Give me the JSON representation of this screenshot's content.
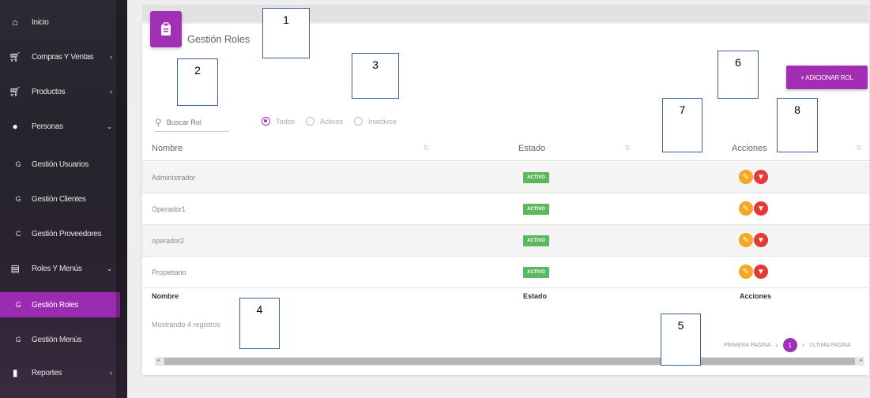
{
  "sidebar": {
    "items": [
      {
        "icon": "home-icon",
        "glyph": "⌂",
        "label": "Inicio",
        "arrow": ""
      },
      {
        "icon": "cart-icon",
        "glyph": "🛒",
        "label": "Compras Y Ventas",
        "arrow": "‹"
      },
      {
        "icon": "products-icon",
        "glyph": "🛒",
        "label": "Productos",
        "arrow": "‹"
      },
      {
        "icon": "person-icon",
        "glyph": "●",
        "label": "Personas",
        "arrow": "⌄"
      },
      {
        "icon": "",
        "glyph": "G",
        "label": "Gestión Usuarios",
        "arrow": ""
      },
      {
        "icon": "",
        "glyph": "G",
        "label": "Gestión Clientes",
        "arrow": ""
      },
      {
        "icon": "",
        "glyph": "C",
        "label": "Gestión Proveedores",
        "arrow": ""
      },
      {
        "icon": "menu-icon",
        "glyph": "▤",
        "label": "Roles Y Menús",
        "arrow": "⌄"
      },
      {
        "icon": "",
        "glyph": "G",
        "label": "Gestión Roles",
        "arrow": ""
      },
      {
        "icon": "",
        "glyph": "G",
        "label": "Gestión Menús",
        "arrow": ""
      },
      {
        "icon": "reports-icon",
        "glyph": "▮",
        "label": "Reportes",
        "arrow": "‹"
      }
    ]
  },
  "page": {
    "title": "Gestión Roles",
    "add_button": "+ ADICIONAR ROL",
    "search_placeholder": "Buscar Rol",
    "filters": [
      "Todos",
      "Activos",
      "Inactivos"
    ],
    "selected_filter": "Todos"
  },
  "table": {
    "headers": [
      "Nombre",
      "Estado",
      "Acciones"
    ],
    "rows": [
      {
        "name": "Administrador",
        "status": "ACTIVO"
      },
      {
        "name": "Operador1",
        "status": "ACTIVO"
      },
      {
        "name": "operador2",
        "status": "ACTIVO"
      },
      {
        "name": "Propietario",
        "status": "ACTIVO"
      }
    ],
    "footer": [
      "Nombre",
      "Estado",
      "Acciones"
    ],
    "showing_text": "Mostrando 4 registros"
  },
  "pagination": {
    "first": "PRIMERA PAGINA",
    "prev": "‹",
    "current": "1",
    "next": "›",
    "last": "ULTIMA PAGINA"
  },
  "callouts": [
    "1",
    "2",
    "3",
    "4",
    "5",
    "6",
    "7",
    "8"
  ],
  "colors": {
    "accent": "#a230b4",
    "active_badge": "#5cb85c",
    "edit": "#f5a623",
    "delete": "#e53935",
    "callout_border": "#3d5f98"
  }
}
